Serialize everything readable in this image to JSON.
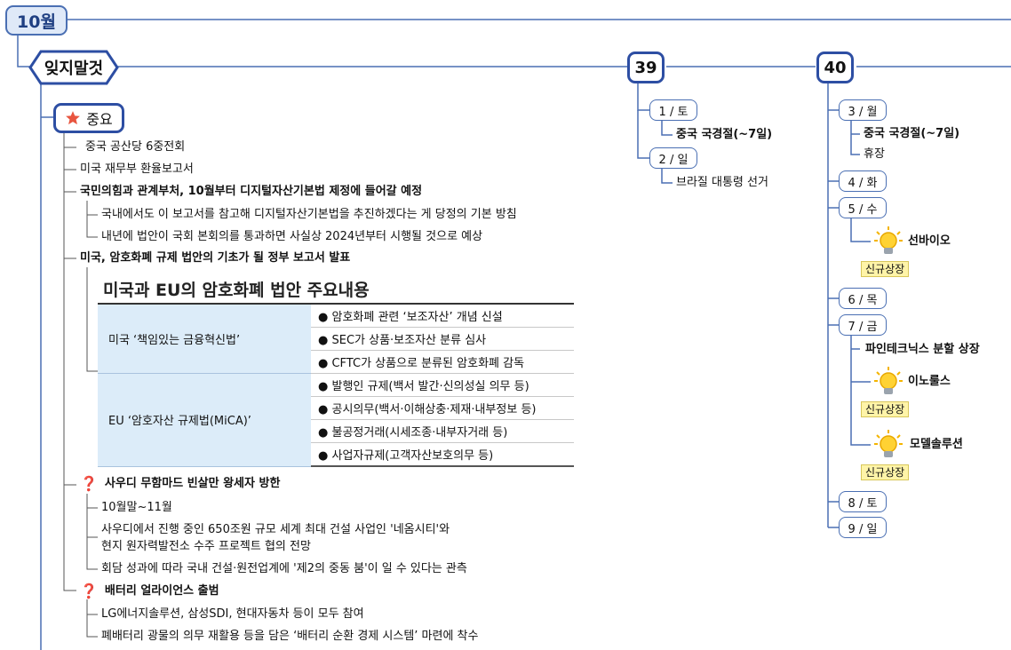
{
  "header": {
    "month": "10월",
    "branch_title": "잊지말것",
    "weeks": [
      "39",
      "40"
    ]
  },
  "important": {
    "label": "중요",
    "items": [
      "중국 공산당 6중전회",
      "미국 재무부 환율보고서",
      "국민의힘과 관계부처, 10월부터 디지털자산기본법 제정에 들어갈 예정",
      "국내에서도 이 보고서를 참고해 디지털자산기본법을 추진하겠다는 게 당정의 기본 방침",
      "내년에 법안이 국회 본회의를 통과하면 사실상 2024년부터 시행될 것으로 예상",
      "미국, 암호화폐 규제 법안의 기초가 될 정부 보고서 발표"
    ],
    "table": {
      "title": "미국과 EU의 암호화폐 법안 주요내용",
      "groups": [
        {
          "name": "미국 ‘책임있는 금융혁신법’",
          "points": [
            "암호화폐 관련 ‘보조자산’ 개념 신설",
            "SEC가 상품·보조자산 분류 심사",
            "CFTC가 상품으로 분류된 암호화폐 감독"
          ]
        },
        {
          "name": "EU ‘암호자산 규제법(MiCA)’",
          "points": [
            "발행인 규제(백서 발간·신의성실 의무 등)",
            "공시의무(백서·이해상충·제재·내부정보 등)",
            "불공정거래(시세조종·내부자거래 등)",
            "사업자규제(고객자산보호의무 등)"
          ]
        }
      ]
    },
    "saudi": {
      "title": "사우디 무함마드 빈살만 왕세자 방한",
      "lines": [
        "10월말~11월",
        "사우디에서 진행 중인 650조원 규모 세계 최대 건설 사업인 '네옴시티'와",
        "현지 원자력발전소 수주 프로젝트 협의 전망",
        "회담 성과에 따라 국내 건설·원전업계에 '제2의 중동 붐'이 일 수 있다는 관측"
      ]
    },
    "battery": {
      "title": "배터리 얼라이언스 출범",
      "lines": [
        "LG에너지솔루션, 삼성SDI, 현대자동차 등이 모두 참여",
        "폐배터리 광물의 의무 재활용 등을 담은 ‘배터리 순환 경제 시스템’ 마련에 착수"
      ]
    }
  },
  "week39": {
    "days": [
      {
        "label": "1 / 토",
        "events": [
          "중국 국경절(~7일)"
        ]
      },
      {
        "label": "2 / 일",
        "events": [
          "브라질 대통령 선거"
        ]
      }
    ]
  },
  "week40": {
    "days": [
      {
        "label": "3 / 월",
        "events": [
          "중국 국경절(~7일)",
          "휴장"
        ]
      },
      {
        "label": "4 / 화"
      },
      {
        "label": "5 / 수",
        "ipo": [
          "선바이오"
        ]
      },
      {
        "label": "6 / 목"
      },
      {
        "label": "7 / 금",
        "events": [
          "파인테크닉스 분할 상장"
        ],
        "ipo": [
          "이노룰스",
          "모델솔루션"
        ]
      },
      {
        "label": "8 / 토"
      },
      {
        "label": "9 / 일"
      }
    ],
    "badge": "신규상장"
  },
  "colors": {
    "accent": "#2d4ea3",
    "line": "#4a6fb3",
    "badge": "#fff4a8",
    "table_left": "#dcecf9"
  },
  "icons": [
    "star-icon",
    "question-icon",
    "bulb-icon"
  ]
}
